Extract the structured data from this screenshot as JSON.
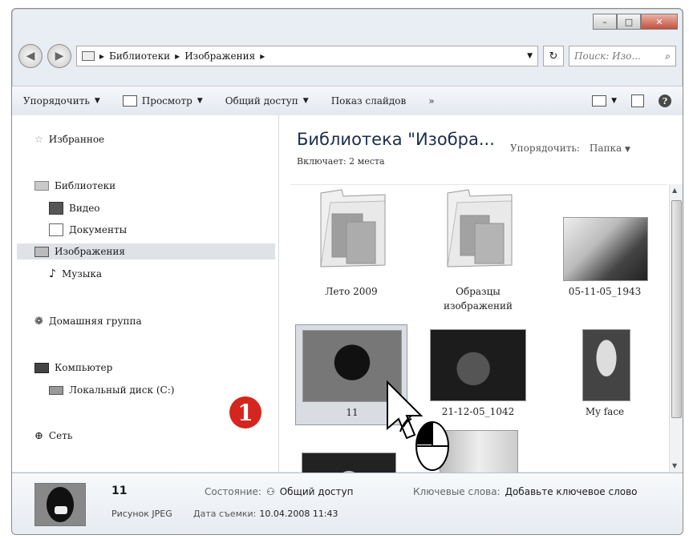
{
  "window": {
    "controls": [
      "–",
      "□",
      "✕"
    ]
  },
  "address": {
    "path": [
      "Библиотеки",
      "Изображения"
    ],
    "search_placeholder": "Поиск: Изо..."
  },
  "toolbar": {
    "organize": "Упорядочить",
    "view": "Просмотр",
    "share": "Общий доступ",
    "slideshow": "Показ слайдов",
    "more": "»"
  },
  "sidebar": {
    "favorites": "Избранное",
    "libraries": "Библиотеки",
    "video": "Видео",
    "documents": "Документы",
    "pictures": "Изображения",
    "music": "Музыка",
    "homegroup": "Домашняя группа",
    "computer": "Компьютер",
    "local_disk": "Локальный диск (C:)",
    "network": "Сеть"
  },
  "main": {
    "title": "Библиотека \"Изобра...",
    "includes": "Включает:",
    "includes_link": "2 места",
    "arrange_label": "Упорядочить:",
    "arrange_value": "Папка",
    "items": [
      {
        "label": "Лето 2009"
      },
      {
        "label": "Образцы изображений"
      },
      {
        "label": "05-11-05_1943"
      },
      {
        "label": "11"
      },
      {
        "label": "21-12-05_1042"
      },
      {
        "label": "My face"
      }
    ]
  },
  "callout": {
    "number": "1"
  },
  "details": {
    "name": "11",
    "type": "Рисунок JPEG",
    "date_label": "Дата съемки:",
    "date_value": "10.04.2008 11:43",
    "state_label": "Состояние:",
    "state_value": "Общий доступ",
    "keywords_label": "Ключевые слова:",
    "keywords_value": "Добавьте ключевое слово"
  }
}
